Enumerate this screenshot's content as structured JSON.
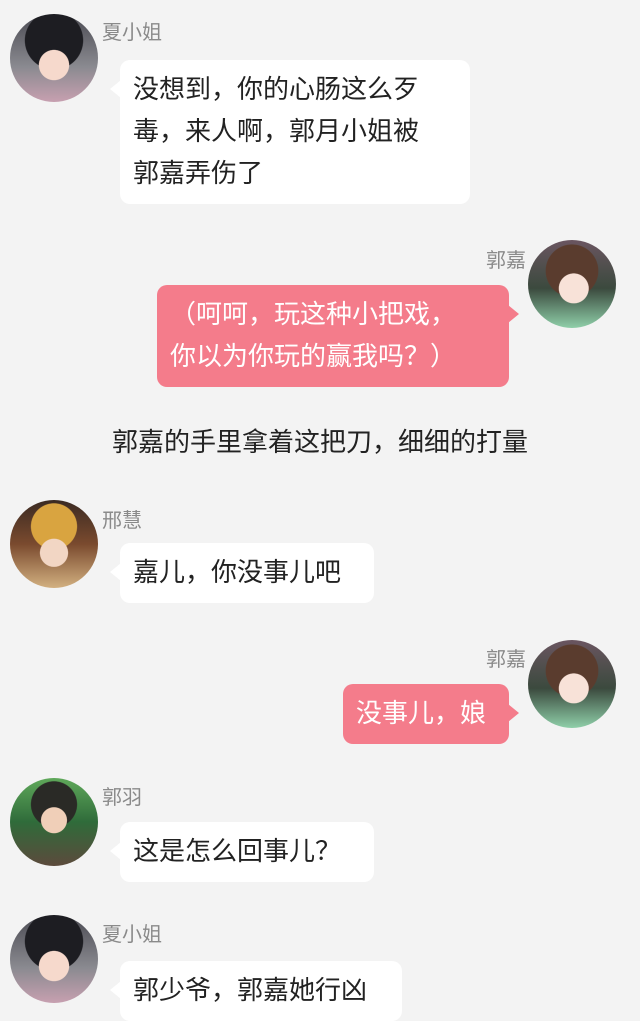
{
  "messages": [
    {
      "speaker": "夏小姐",
      "text": "没想到，你的心肠这么歹毒，来人啊，郭月小姐被郭嘉弄伤了",
      "lines": [
        "没想到，你的心肠这么歹",
        "毒，来人啊，郭月小姐被",
        "郭嘉弄伤了"
      ],
      "avatar": "avatar-xia-xiaojie"
    },
    {
      "speaker": "郭嘉",
      "lines": [
        "（呵呵，玩这种小把戏，",
        "你以为你玩的赢我吗？）"
      ],
      "avatar": "avatar-guo-jia"
    },
    {
      "narration": "郭嘉的手里拿着这把刀，细细的打量"
    },
    {
      "speaker": "邢慧",
      "lines": [
        "嘉儿，你没事儿吧"
      ],
      "avatar": "avatar-xing-hui"
    },
    {
      "speaker": "郭嘉",
      "lines": [
        "没事儿，娘"
      ],
      "avatar": "avatar-guo-jia"
    },
    {
      "speaker": "郭羽",
      "lines": [
        "这是怎么回事儿？"
      ],
      "avatar": "avatar-guo-yu"
    },
    {
      "speaker": "夏小姐",
      "lines": [
        "郭少爷，郭嘉她行凶"
      ],
      "avatar": "avatar-xia-xiaojie"
    }
  ],
  "colors": {
    "background": "#f3f3f3",
    "left_bubble": "#ffffff",
    "right_bubble": "#f47c8b",
    "name": "#8a8a8a"
  }
}
